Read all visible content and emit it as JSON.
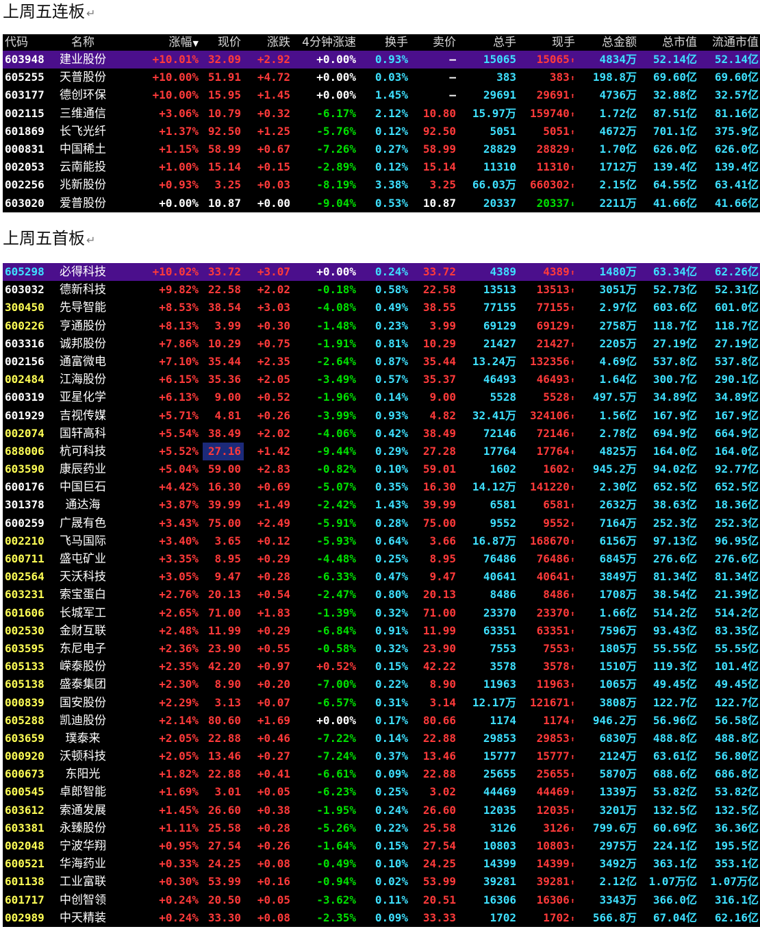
{
  "heading1": "上周五连板",
  "heading2": "上周五首板",
  "return_mark": "↵",
  "colors": {
    "red": "#ff3a3a",
    "green": "#00e000",
    "cyan": "#3ee0ff",
    "white": "#ffffff",
    "yellow": "#ffff55",
    "selected_bg": "#4b0f8c",
    "highlight_bg": "#1c2a7a"
  },
  "columns": [
    "代码",
    "名称",
    "涨幅",
    "现价",
    "涨跌",
    "4分钟涨速",
    "换手",
    "卖价",
    "总手",
    "现手",
    "总金额",
    "总市值",
    "流通市值"
  ],
  "sort_icon": "down-arrow-icon",
  "table1": [
    {
      "code": "603948",
      "name": "建业股份",
      "pct": "+10.01%",
      "price": "32.09",
      "chg": "+2.92",
      "speed": "+0.00%",
      "turn": "0.93%",
      "sell": "–",
      "vol": "15065",
      "cur": "15065",
      "dir": "up",
      "amt": "4834万",
      "mcap": "52.14亿",
      "fcap": "52.14亿",
      "selected": true
    },
    {
      "code": "605255",
      "name": "天普股份",
      "pct": "+10.00%",
      "price": "51.91",
      "chg": "+4.72",
      "speed": "+0.00%",
      "turn": "0.03%",
      "sell": "–",
      "vol": "383",
      "cur": "383",
      "dir": "up",
      "amt": "198.8万",
      "mcap": "69.60亿",
      "fcap": "69.60亿"
    },
    {
      "code": "603177",
      "name": "德创环保",
      "pct": "+10.00%",
      "price": "15.95",
      "chg": "+1.45",
      "speed": "+0.00%",
      "turn": "1.45%",
      "sell": "–",
      "vol": "29691",
      "cur": "29691",
      "dir": "up",
      "amt": "4736万",
      "mcap": "32.88亿",
      "fcap": "32.57亿"
    },
    {
      "code": "002115",
      "name": "三维通信",
      "pct": "+3.06%",
      "price": "10.79",
      "chg": "+0.32",
      "speed": "-6.17%",
      "turn": "2.12%",
      "sell": "10.80",
      "vol": "15.97万",
      "cur": "159740",
      "dir": "up",
      "amt": "1.72亿",
      "mcap": "87.51亿",
      "fcap": "81.16亿"
    },
    {
      "code": "601869",
      "name": "长飞光纤",
      "pct": "+1.37%",
      "price": "92.50",
      "chg": "+1.25",
      "speed": "-5.76%",
      "turn": "0.12%",
      "sell": "92.50",
      "vol": "5051",
      "cur": "5051",
      "dir": "up",
      "amt": "4672万",
      "mcap": "701.1亿",
      "fcap": "375.9亿"
    },
    {
      "code": "000831",
      "name": "中国稀土",
      "pct": "+1.15%",
      "price": "58.99",
      "chg": "+0.67",
      "speed": "-7.26%",
      "turn": "0.27%",
      "sell": "58.99",
      "vol": "28829",
      "cur": "28829",
      "dir": "up",
      "amt": "1.70亿",
      "mcap": "626.0亿",
      "fcap": "626.0亿"
    },
    {
      "code": "002053",
      "name": "云南能投",
      "pct": "+1.00%",
      "price": "15.14",
      "chg": "+0.15",
      "speed": "-2.89%",
      "turn": "0.12%",
      "sell": "15.14",
      "vol": "11310",
      "cur": "11310",
      "dir": "up",
      "amt": "1712万",
      "mcap": "139.4亿",
      "fcap": "139.4亿"
    },
    {
      "code": "002256",
      "name": "兆新股份",
      "pct": "+0.93%",
      "price": "3.25",
      "chg": "+0.03",
      "speed": "-8.19%",
      "turn": "3.38%",
      "sell": "3.25",
      "vol": "66.03万",
      "cur": "660302",
      "dir": "up",
      "amt": "2.15亿",
      "mcap": "64.55亿",
      "fcap": "63.41亿"
    },
    {
      "code": "603020",
      "name": "爱普股份",
      "pct": "+0.00%",
      "price": "10.87",
      "chg": "+0.00",
      "speed": "-9.04%",
      "turn": "0.53%",
      "sell": "10.87",
      "vol": "20337",
      "cur": "20337",
      "dir": "down",
      "amt": "2211万",
      "mcap": "41.66亿",
      "fcap": "41.66亿",
      "flat": true
    }
  ],
  "table2": [
    {
      "code": "605298",
      "name": "必得科技",
      "pct": "+10.02%",
      "price": "33.72",
      "chg": "+3.07",
      "speed": "+0.00%",
      "turn": "0.24%",
      "sell": "33.72",
      "vol": "4389",
      "cur": "4389",
      "dir": "up",
      "amt": "1480万",
      "mcap": "63.34亿",
      "fcap": "62.26亿",
      "selected": true
    },
    {
      "code": "603032",
      "name": "德新科技",
      "pct": "+9.82%",
      "price": "22.58",
      "chg": "+2.02",
      "speed": "-0.18%",
      "turn": "0.58%",
      "sell": "22.58",
      "vol": "13513",
      "cur": "13513",
      "dir": "up",
      "amt": "3051万",
      "mcap": "52.73亿",
      "fcap": "52.31亿"
    },
    {
      "code": "300450",
      "name": "先导智能",
      "pct": "+8.53%",
      "price": "38.54",
      "chg": "+3.03",
      "speed": "-4.08%",
      "turn": "0.49%",
      "sell": "38.55",
      "vol": "77155",
      "cur": "77155",
      "dir": "up",
      "amt": "2.97亿",
      "mcap": "603.6亿",
      "fcap": "601.0亿"
    },
    {
      "code": "600226",
      "name": "亨通股份",
      "pct": "+8.13%",
      "price": "3.99",
      "chg": "+0.30",
      "speed": "-1.48%",
      "turn": "0.23%",
      "sell": "3.99",
      "vol": "69129",
      "cur": "69129",
      "dir": "up",
      "amt": "2758万",
      "mcap": "118.7亿",
      "fcap": "118.7亿"
    },
    {
      "code": "603316",
      "name": "诚邦股份",
      "pct": "+7.86%",
      "price": "10.29",
      "chg": "+0.75",
      "speed": "-1.91%",
      "turn": "0.81%",
      "sell": "10.29",
      "vol": "21427",
      "cur": "21427",
      "dir": "up",
      "amt": "2205万",
      "mcap": "27.19亿",
      "fcap": "27.19亿"
    },
    {
      "code": "002156",
      "name": "通富微电",
      "pct": "+7.10%",
      "price": "35.44",
      "chg": "+2.35",
      "speed": "-2.64%",
      "turn": "0.87%",
      "sell": "35.44",
      "vol": "13.24万",
      "cur": "132356",
      "dir": "up",
      "amt": "4.69亿",
      "mcap": "537.8亿",
      "fcap": "537.8亿"
    },
    {
      "code": "002484",
      "name": "江海股份",
      "pct": "+6.15%",
      "price": "35.36",
      "chg": "+2.05",
      "speed": "-3.49%",
      "turn": "0.57%",
      "sell": "35.37",
      "vol": "46493",
      "cur": "46493",
      "dir": "up",
      "amt": "1.64亿",
      "mcap": "300.7亿",
      "fcap": "290.1亿"
    },
    {
      "code": "600319",
      "name": "亚星化学",
      "pct": "+6.13%",
      "price": "9.00",
      "chg": "+0.52",
      "speed": "-1.96%",
      "turn": "0.14%",
      "sell": "9.00",
      "vol": "5528",
      "cur": "5528",
      "dir": "up",
      "amt": "497.5万",
      "mcap": "34.89亿",
      "fcap": "34.89亿"
    },
    {
      "code": "601929",
      "name": "吉视传媒",
      "pct": "+5.71%",
      "price": "4.81",
      "chg": "+0.26",
      "speed": "-3.99%",
      "turn": "0.93%",
      "sell": "4.82",
      "vol": "32.41万",
      "cur": "324106",
      "dir": "up",
      "amt": "1.56亿",
      "mcap": "167.9亿",
      "fcap": "167.9亿"
    },
    {
      "code": "002074",
      "name": "国轩高科",
      "pct": "+5.54%",
      "price": "38.49",
      "chg": "+2.02",
      "speed": "-4.06%",
      "turn": "0.42%",
      "sell": "38.49",
      "vol": "72146",
      "cur": "72146",
      "dir": "up",
      "amt": "2.78亿",
      "mcap": "694.9亿",
      "fcap": "664.9亿"
    },
    {
      "code": "688006",
      "name": "杭可科技",
      "pct": "+5.52%",
      "price": "27.16",
      "chg": "+1.42",
      "speed": "-9.44%",
      "turn": "0.29%",
      "sell": "27.28",
      "vol": "17764",
      "cur": "17764",
      "dir": "up",
      "amt": "4825万",
      "mcap": "164.0亿",
      "fcap": "164.0亿",
      "price_hl": true
    },
    {
      "code": "603590",
      "name": "康辰药业",
      "pct": "+5.04%",
      "price": "59.00",
      "chg": "+2.83",
      "speed": "-0.82%",
      "turn": "0.10%",
      "sell": "59.01",
      "vol": "1602",
      "cur": "1602",
      "dir": "up",
      "amt": "945.2万",
      "mcap": "94.02亿",
      "fcap": "92.77亿"
    },
    {
      "code": "600176",
      "name": "中国巨石",
      "pct": "+4.42%",
      "price": "16.30",
      "chg": "+0.69",
      "speed": "-5.07%",
      "turn": "0.35%",
      "sell": "16.30",
      "vol": "14.12万",
      "cur": "141220",
      "dir": "up",
      "amt": "2.30亿",
      "mcap": "652.5亿",
      "fcap": "652.5亿"
    },
    {
      "code": "301378",
      "name": "通达海",
      "pct": "+3.87%",
      "price": "39.99",
      "chg": "+1.49",
      "speed": "-2.42%",
      "turn": "1.43%",
      "sell": "39.99",
      "vol": "6581",
      "cur": "6581",
      "dir": "up",
      "amt": "2632万",
      "mcap": "38.63亿",
      "fcap": "18.36亿"
    },
    {
      "code": "600259",
      "name": "广晟有色",
      "pct": "+3.43%",
      "price": "75.00",
      "chg": "+2.49",
      "speed": "-5.91%",
      "turn": "0.28%",
      "sell": "75.00",
      "vol": "9552",
      "cur": "9552",
      "dir": "up",
      "amt": "7164万",
      "mcap": "252.3亿",
      "fcap": "252.3亿"
    },
    {
      "code": "002210",
      "name": "飞马国际",
      "pct": "+3.40%",
      "price": "3.65",
      "chg": "+0.12",
      "speed": "-5.93%",
      "turn": "0.64%",
      "sell": "3.66",
      "vol": "16.87万",
      "cur": "168670",
      "dir": "up",
      "amt": "6156万",
      "mcap": "97.13亿",
      "fcap": "96.95亿"
    },
    {
      "code": "600711",
      "name": "盛屯矿业",
      "pct": "+3.35%",
      "price": "8.95",
      "chg": "+0.29",
      "speed": "-4.48%",
      "turn": "0.25%",
      "sell": "8.95",
      "vol": "76486",
      "cur": "76486",
      "dir": "up",
      "amt": "6845万",
      "mcap": "276.6亿",
      "fcap": "276.6亿"
    },
    {
      "code": "002564",
      "name": "天沃科技",
      "pct": "+3.05%",
      "price": "9.47",
      "chg": "+0.28",
      "speed": "-6.33%",
      "turn": "0.47%",
      "sell": "9.47",
      "vol": "40641",
      "cur": "40641",
      "dir": "up",
      "amt": "3849万",
      "mcap": "81.34亿",
      "fcap": "81.34亿"
    },
    {
      "code": "603231",
      "name": "索宝蛋白",
      "pct": "+2.76%",
      "price": "20.13",
      "chg": "+0.54",
      "speed": "-2.47%",
      "turn": "0.80%",
      "sell": "20.13",
      "vol": "8486",
      "cur": "8486",
      "dir": "up",
      "amt": "1708万",
      "mcap": "38.54亿",
      "fcap": "21.39亿"
    },
    {
      "code": "601606",
      "name": "长城军工",
      "pct": "+2.65%",
      "price": "71.00",
      "chg": "+1.83",
      "speed": "-1.39%",
      "turn": "0.32%",
      "sell": "71.00",
      "vol": "23370",
      "cur": "23370",
      "dir": "up",
      "amt": "1.66亿",
      "mcap": "514.2亿",
      "fcap": "514.2亿"
    },
    {
      "code": "002530",
      "name": "金财互联",
      "pct": "+2.48%",
      "price": "11.99",
      "chg": "+0.29",
      "speed": "-6.84%",
      "turn": "0.91%",
      "sell": "11.99",
      "vol": "63351",
      "cur": "63351",
      "dir": "up",
      "amt": "7596万",
      "mcap": "93.43亿",
      "fcap": "83.35亿"
    },
    {
      "code": "603595",
      "name": "东尼电子",
      "pct": "+2.36%",
      "price": "23.90",
      "chg": "+0.55",
      "speed": "-0.58%",
      "turn": "0.32%",
      "sell": "23.90",
      "vol": "7553",
      "cur": "7553",
      "dir": "up",
      "amt": "1805万",
      "mcap": "55.55亿",
      "fcap": "55.55亿"
    },
    {
      "code": "605133",
      "name": "嵘泰股份",
      "pct": "+2.35%",
      "price": "42.20",
      "chg": "+0.97",
      "speed": "+0.52%",
      "turn": "0.15%",
      "sell": "42.22",
      "vol": "3578",
      "cur": "3578",
      "dir": "up",
      "amt": "1510万",
      "mcap": "119.3亿",
      "fcap": "101.4亿",
      "speed_up": true
    },
    {
      "code": "605138",
      "name": "盛泰集团",
      "pct": "+2.30%",
      "price": "8.90",
      "chg": "+0.20",
      "speed": "-7.00%",
      "turn": "0.22%",
      "sell": "8.90",
      "vol": "11963",
      "cur": "11963",
      "dir": "up",
      "amt": "1065万",
      "mcap": "49.45亿",
      "fcap": "49.45亿"
    },
    {
      "code": "000839",
      "name": "国安股份",
      "pct": "+2.29%",
      "price": "3.13",
      "chg": "+0.07",
      "speed": "-6.57%",
      "turn": "0.31%",
      "sell": "3.14",
      "vol": "12.17万",
      "cur": "121671",
      "dir": "up",
      "amt": "3808万",
      "mcap": "122.7亿",
      "fcap": "122.7亿"
    },
    {
      "code": "605288",
      "name": "凯迪股份",
      "pct": "+2.14%",
      "price": "80.60",
      "chg": "+1.69",
      "speed": "+0.00%",
      "turn": "0.17%",
      "sell": "80.66",
      "vol": "1174",
      "cur": "1174",
      "dir": "up",
      "amt": "946.2万",
      "mcap": "56.96亿",
      "fcap": "56.58亿",
      "speed_flat": true
    },
    {
      "code": "603659",
      "name": "璞泰来",
      "pct": "+2.05%",
      "price": "22.88",
      "chg": "+0.46",
      "speed": "-7.22%",
      "turn": "0.14%",
      "sell": "22.88",
      "vol": "29853",
      "cur": "29853",
      "dir": "up",
      "amt": "6830万",
      "mcap": "488.8亿",
      "fcap": "488.8亿"
    },
    {
      "code": "000920",
      "name": "沃顿科技",
      "pct": "+2.05%",
      "price": "13.46",
      "chg": "+0.27",
      "speed": "-7.24%",
      "turn": "0.37%",
      "sell": "13.46",
      "vol": "15777",
      "cur": "15777",
      "dir": "up",
      "amt": "2124万",
      "mcap": "63.61亿",
      "fcap": "56.80亿"
    },
    {
      "code": "600673",
      "name": "东阳光",
      "pct": "+1.82%",
      "price": "22.88",
      "chg": "+0.41",
      "speed": "-6.61%",
      "turn": "0.09%",
      "sell": "22.88",
      "vol": "25655",
      "cur": "25655",
      "dir": "up",
      "amt": "5870万",
      "mcap": "688.6亿",
      "fcap": "686.8亿"
    },
    {
      "code": "600545",
      "name": "卓郎智能",
      "pct": "+1.69%",
      "price": "3.01",
      "chg": "+0.05",
      "speed": "-6.23%",
      "turn": "0.25%",
      "sell": "3.02",
      "vol": "44469",
      "cur": "44469",
      "dir": "up",
      "amt": "1339万",
      "mcap": "53.82亿",
      "fcap": "53.82亿"
    },
    {
      "code": "603612",
      "name": "索通发展",
      "pct": "+1.45%",
      "price": "26.60",
      "chg": "+0.38",
      "speed": "-1.95%",
      "turn": "0.24%",
      "sell": "26.60",
      "vol": "12035",
      "cur": "12035",
      "dir": "up",
      "amt": "3201万",
      "mcap": "132.5亿",
      "fcap": "132.5亿"
    },
    {
      "code": "603381",
      "name": "永臻股份",
      "pct": "+1.11%",
      "price": "25.58",
      "chg": "+0.28",
      "speed": "-5.26%",
      "turn": "0.22%",
      "sell": "25.58",
      "vol": "3126",
      "cur": "3126",
      "dir": "up",
      "amt": "799.6万",
      "mcap": "60.69亿",
      "fcap": "36.36亿"
    },
    {
      "code": "002048",
      "name": "宁波华翔",
      "pct": "+0.95%",
      "price": "27.54",
      "chg": "+0.26",
      "speed": "-1.64%",
      "turn": "0.15%",
      "sell": "27.54",
      "vol": "10803",
      "cur": "10803",
      "dir": "up",
      "amt": "2975万",
      "mcap": "224.1亿",
      "fcap": "195.5亿"
    },
    {
      "code": "600521",
      "name": "华海药业",
      "pct": "+0.33%",
      "price": "24.25",
      "chg": "+0.08",
      "speed": "-0.49%",
      "turn": "0.10%",
      "sell": "24.25",
      "vol": "14399",
      "cur": "14399",
      "dir": "up",
      "amt": "3492万",
      "mcap": "363.1亿",
      "fcap": "353.1亿"
    },
    {
      "code": "601138",
      "name": "工业富联",
      "pct": "+0.30%",
      "price": "53.99",
      "chg": "+0.16",
      "speed": "-0.94%",
      "turn": "0.02%",
      "sell": "53.99",
      "vol": "39281",
      "cur": "39281",
      "dir": "up",
      "amt": "2.12亿",
      "mcap": "1.07万亿",
      "fcap": "1.07万亿"
    },
    {
      "code": "601717",
      "name": "中创智领",
      "pct": "+0.24%",
      "price": "20.50",
      "chg": "+0.05",
      "speed": "-3.62%",
      "turn": "0.11%",
      "sell": "20.51",
      "vol": "16306",
      "cur": "16306",
      "dir": "up",
      "amt": "3343万",
      "mcap": "366.0亿",
      "fcap": "316.1亿"
    },
    {
      "code": "002989",
      "name": "中天精装",
      "pct": "+0.24%",
      "price": "33.30",
      "chg": "+0.08",
      "speed": "-2.35%",
      "turn": "0.09%",
      "sell": "33.33",
      "vol": "1702",
      "cur": "1702",
      "dir": "up",
      "amt": "566.8万",
      "mcap": "67.04亿",
      "fcap": "62.16亿"
    }
  ]
}
